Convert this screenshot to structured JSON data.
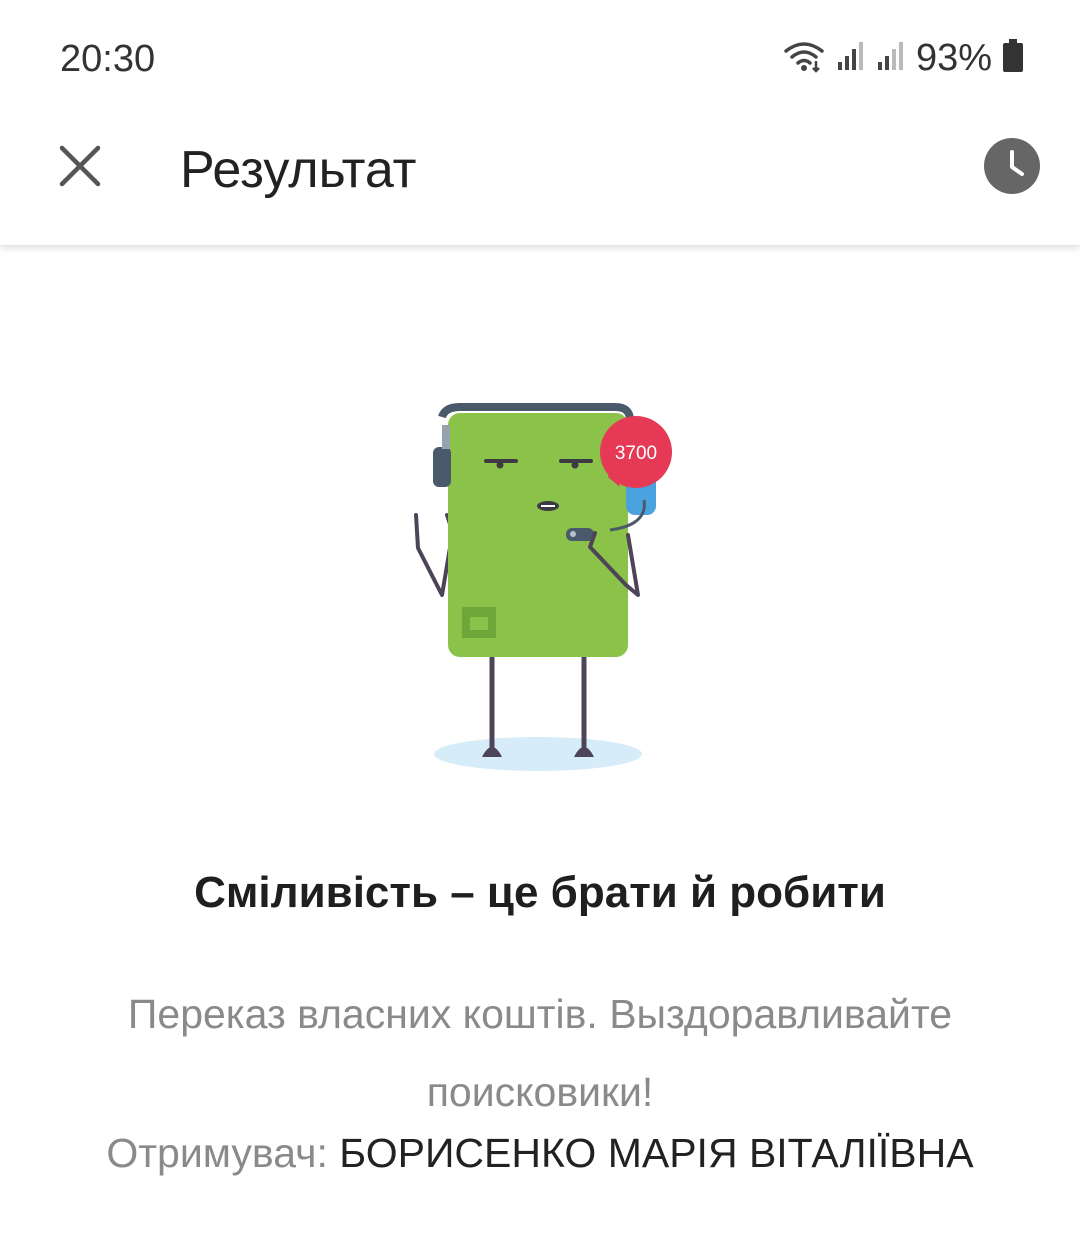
{
  "status_bar": {
    "time": "20:30",
    "battery_percent": "93%",
    "icons": [
      "wifi-icon",
      "signal-icon",
      "signal-icon",
      "battery-icon"
    ]
  },
  "app_bar": {
    "title": "Результат",
    "close_icon": "close-icon",
    "history_icon": "clock-icon"
  },
  "illustration": {
    "badge_text": "3700",
    "colors": {
      "card": "#8bc34a",
      "badge": "#e53956",
      "headphones": "#4a5a6a",
      "earcup": "#4aa3df",
      "shadow": "#d6ecf8"
    }
  },
  "result": {
    "headline": "Сміливість – це брати й робити",
    "description": "Переказ власних коштів. Выздоравливайте поисковики!",
    "recipient_label": "Отримувач: ",
    "recipient_name": "БОРИСЕНКО МАРІЯ ВІТАЛІЇВНА"
  }
}
